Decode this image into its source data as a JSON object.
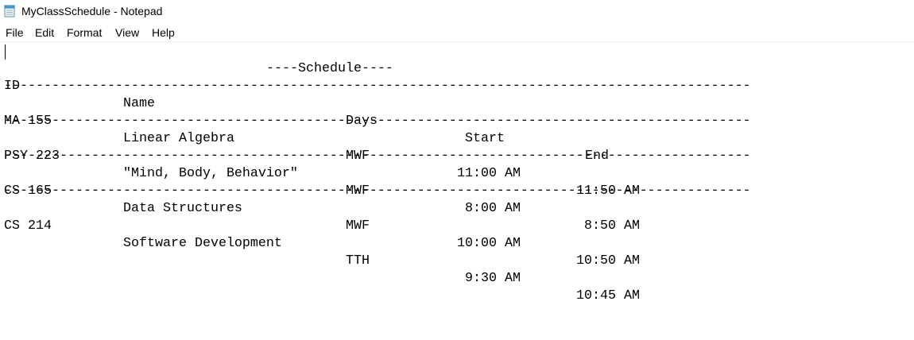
{
  "window": {
    "title": "MyClassSchedule - Notepad",
    "icon": "notepad-icon"
  },
  "menu": {
    "file": "File",
    "edit": "Edit",
    "format": "Format",
    "view": "View",
    "help": "Help"
  },
  "document": {
    "heading": "----Schedule----",
    "header_row": {
      "id": "ID",
      "name": "Name",
      "days": "Days",
      "start": "Start",
      "end": "End"
    },
    "separator": "----------------------------------------------------------------------------------------------",
    "rows": [
      {
        "id": "MA 155",
        "name": "Linear Algebra",
        "days": "MWF",
        "start": "11:00 AM",
        "end": "11:50 AM"
      },
      {
        "id": "PSY 223",
        "name": "\"Mind, Body, Behavior\"",
        "days": "MWF",
        "start": "8:00 AM",
        "end": "8:50 AM"
      },
      {
        "id": "CS 165",
        "name": "Data Structures",
        "days": "MWF",
        "start": "10:00 AM",
        "end": "10:50 AM"
      },
      {
        "id": "CS 214",
        "name": "Software Development",
        "days": "TTH",
        "start": "9:30 AM",
        "end": "10:45 AM"
      }
    ]
  }
}
